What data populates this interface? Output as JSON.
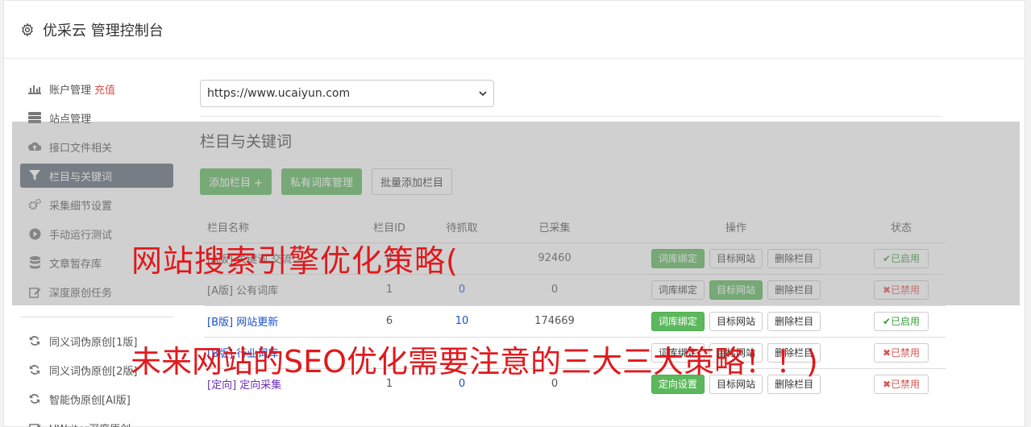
{
  "header": {
    "title": "优采云 管理控制台"
  },
  "sidebar": {
    "items": [
      {
        "label": "账户管理",
        "extra": "充值",
        "icon": "bar-chart-icon"
      },
      {
        "label": "站点管理",
        "icon": "server-icon"
      },
      {
        "label": "接口文件相关",
        "icon": "cloud-upload-icon"
      },
      {
        "label": "栏目与关键词",
        "icon": "filter-icon",
        "active": true
      },
      {
        "label": "采集细节设置",
        "icon": "gears-icon"
      },
      {
        "label": "手动运行测试",
        "icon": "play-circle-icon"
      },
      {
        "label": "文章暂存库",
        "icon": "database-icon"
      },
      {
        "label": "深度原创任务",
        "icon": "edit-icon"
      }
    ],
    "items2": [
      {
        "label": "同义词伪原创[1版]",
        "icon": "refresh-icon"
      },
      {
        "label": "同义词伪原创[2版]",
        "icon": "refresh-icon"
      },
      {
        "label": "智能伪原创[AI版]",
        "icon": "refresh-icon"
      },
      {
        "label": "UWriter深度原创",
        "icon": "edit-icon"
      }
    ]
  },
  "main": {
    "site_select": "https://www.ucaiyun.com",
    "section_title": "栏目与关键词",
    "buttons": {
      "add": "添加栏目 +",
      "private": "私有词库管理",
      "batch": "批量添加栏目"
    },
    "table": {
      "headers": [
        "栏目名称",
        "栏目ID",
        "待抓取",
        "已采集",
        "操作",
        "状态"
      ],
      "rows": [
        {
          "name": "[A版] 关键词 交流",
          "id": "4",
          "pending": "",
          "collected": "92460",
          "btn1": "词库绑定",
          "btn2": "目标网站",
          "btn3": "删除栏目",
          "status": "已启用"
        },
        {
          "name": "[A版] 公有词库",
          "id": "1",
          "pending": "0",
          "collected": "0",
          "btn1": "词库绑定",
          "btn2": "目标网站",
          "btn3": "删除栏目",
          "status": "已禁用"
        },
        {
          "name": "[B版] 网站更新",
          "id": "6",
          "pending": "10",
          "collected": "174669",
          "btn1": "词库绑定",
          "btn2": "目标网站",
          "btn3": "删除栏目",
          "status": "已启用"
        },
        {
          "name": "[B版] 行业词库",
          "id": "",
          "pending": "",
          "collected": "",
          "btn1": "词库绑定",
          "btn2": "目标网站",
          "btn3": "删除栏目",
          "status": "已禁用"
        },
        {
          "name": "[定向] 定向采集",
          "id": "1",
          "pending": "0",
          "collected": "0",
          "btn1": "定向设置",
          "btn2": "目标网站",
          "btn3": "删除栏目",
          "status": "已禁用"
        }
      ]
    }
  },
  "watermark": {
    "line1": "网站搜索引擎优化策略(",
    "line2": "未来网站的SEO优化需要注意的三大三大策略！！)"
  },
  "colors": {
    "green": "#5cb85c",
    "active_nav": "#5d6977",
    "watermark": "#e0191d",
    "link": "#1a4ec9"
  }
}
